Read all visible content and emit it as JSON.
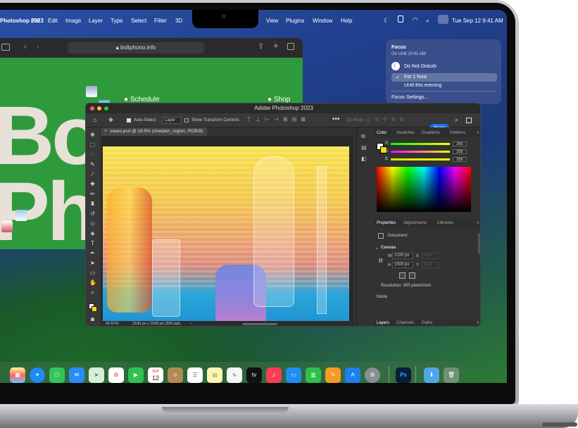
{
  "menubar": {
    "app": "Photoshop 2023",
    "items": [
      "File",
      "Edit",
      "Image",
      "Layer",
      "Type",
      "Select",
      "Filter",
      "3D",
      "View",
      "Plugins",
      "Window",
      "Help"
    ],
    "clock": "Tue Sep 12  9:41 AM"
  },
  "focus_menu": {
    "title": "Focus",
    "subtitle": "On Until 10:41 AM",
    "dnd": "Do Not Disturb",
    "opt1": "For 1 hour",
    "opt2": "Until this evening",
    "settings": "Focus Settings..."
  },
  "safari": {
    "url": "boltphono.info",
    "link_schedule": "Schedule",
    "link_shop": "Shop",
    "big1": "Bolt",
    "big2": "Pho"
  },
  "photoshop": {
    "title": "Adobe Photoshop 2023",
    "auto_select_label": "Auto-Select:",
    "layer_dropdown": "Layer",
    "show_transform": "Show Transform Controls",
    "mode_3d": "3D Mode:",
    "share": "Share",
    "doc_tab": "vases.psd @ 18.5% (sharpen_region, RGB/8)",
    "zoom": "66.67%",
    "doc_info": "2100 px x 1500 px (300 ppi)",
    "color_tabs": [
      "Color",
      "Swatches",
      "Gradients",
      "Patterns"
    ],
    "rgb": [
      {
        "label": "R",
        "value": "255"
      },
      {
        "label": "G",
        "value": "255"
      },
      {
        "label": "B",
        "value": "255"
      }
    ],
    "props_tabs": [
      "Properties",
      "Adjustments",
      "Libraries"
    ],
    "document_label": "Document",
    "canvas_label": "Canvas",
    "w_label": "W",
    "h_label": "H",
    "x_label": "X",
    "y_label": "Y",
    "width": "2100 px",
    "height": "1500 px",
    "x_placeholder": "0 px",
    "y_placeholder": "0 px",
    "resolution": "Resolution: 300 pixels/inch",
    "mode": "Mode",
    "layers_tabs": [
      "Layers",
      "Channels",
      "Paths"
    ]
  },
  "dock": {
    "calendar_month": "SEP",
    "calendar_day": "12",
    "ps_label": "Ps",
    "tv_label": "tv"
  }
}
